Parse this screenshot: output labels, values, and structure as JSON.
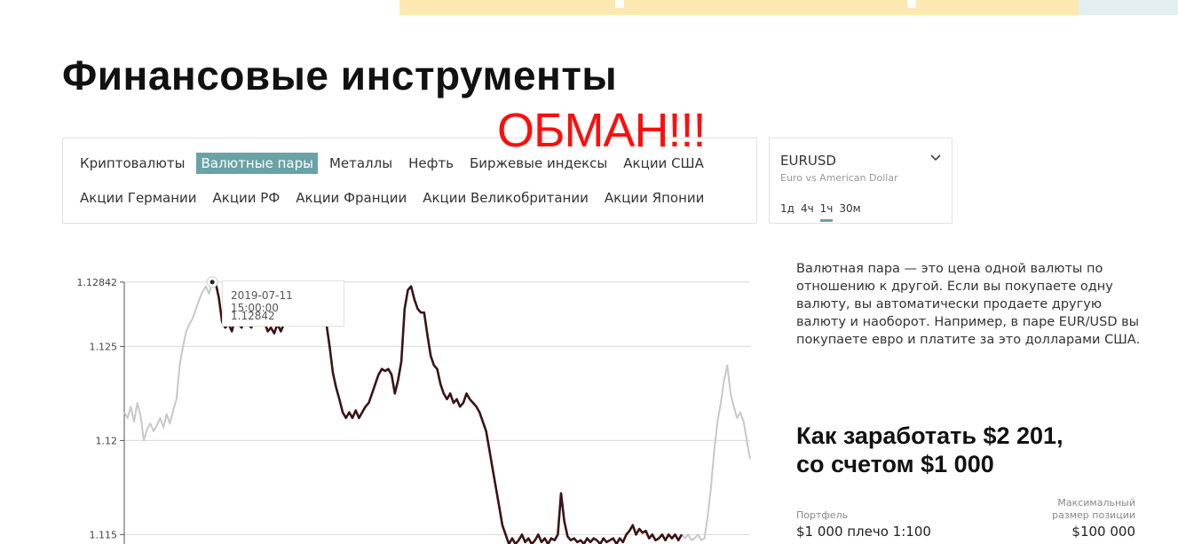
{
  "page_title": "Финансовые инструменты",
  "scam_overlay": "ОБМАН!!!",
  "categories": {
    "row1": [
      "Криптовалюты",
      "Валютные пары",
      "Металлы",
      "Нефть",
      "Биржевые индексы",
      "Акции США"
    ],
    "row2": [
      "Акции Германии",
      "Акции РФ",
      "Акции Франции",
      "Акции Великобритании",
      "Акции Японии"
    ],
    "active": "Валютные пары"
  },
  "pair": {
    "name": "EURUSD",
    "subtitle": "Euro vs American Dollar",
    "timeframes": [
      "1д",
      "4ч",
      "1ч",
      "30м"
    ],
    "active_timeframe": "1ч"
  },
  "tooltip": {
    "date": "2019-07-11 15:00:00",
    "value": "1.12842"
  },
  "description": "Валютная пара — это цена одной валюты по отношению к другой. Если вы покупаете одну валюту, вы автоматически продаете другую валюту и наоборот. Например, в паре EUR/USD вы покупаете евро и платите за это долларами США.",
  "earn": {
    "line1": "Как заработать $2 201,",
    "line2": "со счетом $1 000"
  },
  "portfolio": {
    "label": "Портфель",
    "value": "$1 000 плечо 1:100"
  },
  "max_position": {
    "label_line1": "Максимальный",
    "label_line2": "размер позиции",
    "value": "$100 000"
  },
  "colors": {
    "accent": "#6aa2a6",
    "scam": "#ff0d0d",
    "series_main": "#3a1414",
    "series_faded": "#c8c8c8"
  },
  "chart_data": {
    "type": "line",
    "y_ticks": [
      "1.12842",
      "1.125",
      "1.12",
      "1.115"
    ],
    "y_tick_values": [
      1.12842,
      1.125,
      1.12,
      1.115
    ],
    "ylim": [
      1.1145,
      1.1295
    ],
    "highlight_point": {
      "x": "2019-07-11 15:00:00",
      "y": 1.12842
    },
    "series": [
      {
        "values": [
          1.1215,
          1.1212,
          1.1218,
          1.121,
          1.122,
          1.1213,
          1.12,
          1.1206,
          1.1209,
          1.1205,
          1.1208,
          1.1212,
          1.1207,
          1.1214,
          1.1209,
          1.1216,
          1.1222,
          1.124,
          1.125,
          1.1258,
          1.1262,
          1.1265,
          1.127,
          1.1275,
          1.1279,
          1.1282,
          1.1278,
          1.1284,
          1.1284,
          1.1276,
          1.1263,
          1.126,
          1.1262,
          1.1258,
          1.1265,
          1.1262,
          1.126,
          1.1265,
          1.1262,
          1.126,
          1.1268,
          1.1262,
          1.1266,
          1.1263,
          1.1258,
          1.126,
          1.1257,
          1.1262,
          1.1258,
          1.1262,
          1.1268,
          1.1266,
          1.1264,
          1.127,
          1.1268,
          1.1262,
          1.1265,
          1.1263,
          1.1263,
          1.1264,
          1.1262,
          1.1263,
          1.1262,
          1.125,
          1.1236,
          1.1228,
          1.1222,
          1.1215,
          1.1212,
          1.1215,
          1.1212,
          1.1216,
          1.1212,
          1.1215,
          1.1218,
          1.122,
          1.1225,
          1.123,
          1.1235,
          1.1238,
          1.1237,
          1.1238,
          1.1235,
          1.1225,
          1.1232,
          1.1242,
          1.127,
          1.128,
          1.1282,
          1.1275,
          1.127,
          1.1268,
          1.1268,
          1.1256,
          1.1245,
          1.124,
          1.1238,
          1.123,
          1.1225,
          1.1222,
          1.1225,
          1.122,
          1.1222,
          1.1218,
          1.122,
          1.1225,
          1.1222,
          1.122,
          1.1218,
          1.1215,
          1.121,
          1.1205,
          1.1195,
          1.1185,
          1.1175,
          1.1165,
          1.1155,
          1.115,
          1.1145,
          1.1148,
          1.1145,
          1.1147,
          1.115,
          1.1146,
          1.1148,
          1.1145,
          1.1147,
          1.115,
          1.1146,
          1.1148,
          1.1145,
          1.1148,
          1.1147,
          1.115,
          1.1172,
          1.1157,
          1.1149,
          1.1147,
          1.1148,
          1.1146,
          1.1147,
          1.1145,
          1.1148,
          1.1146,
          1.1148,
          1.1147,
          1.1145,
          1.1148,
          1.1146,
          1.1147,
          1.1148,
          1.1145,
          1.1148,
          1.1146,
          1.115,
          1.1152,
          1.1155,
          1.115,
          1.1153,
          1.1151,
          1.1152,
          1.1148,
          1.115,
          1.1147,
          1.1148,
          1.115,
          1.1147,
          1.115,
          1.1148,
          1.115,
          1.1147,
          1.115,
          1.1148,
          1.115,
          1.1147,
          1.1148,
          1.115,
          1.1147,
          1.1148,
          1.116,
          1.1175,
          1.1195,
          1.121,
          1.122,
          1.1232,
          1.124,
          1.1225,
          1.1218,
          1.1212,
          1.1215,
          1.121,
          1.12,
          1.119
        ]
      }
    ],
    "main_range": [
      27,
      171
    ]
  }
}
